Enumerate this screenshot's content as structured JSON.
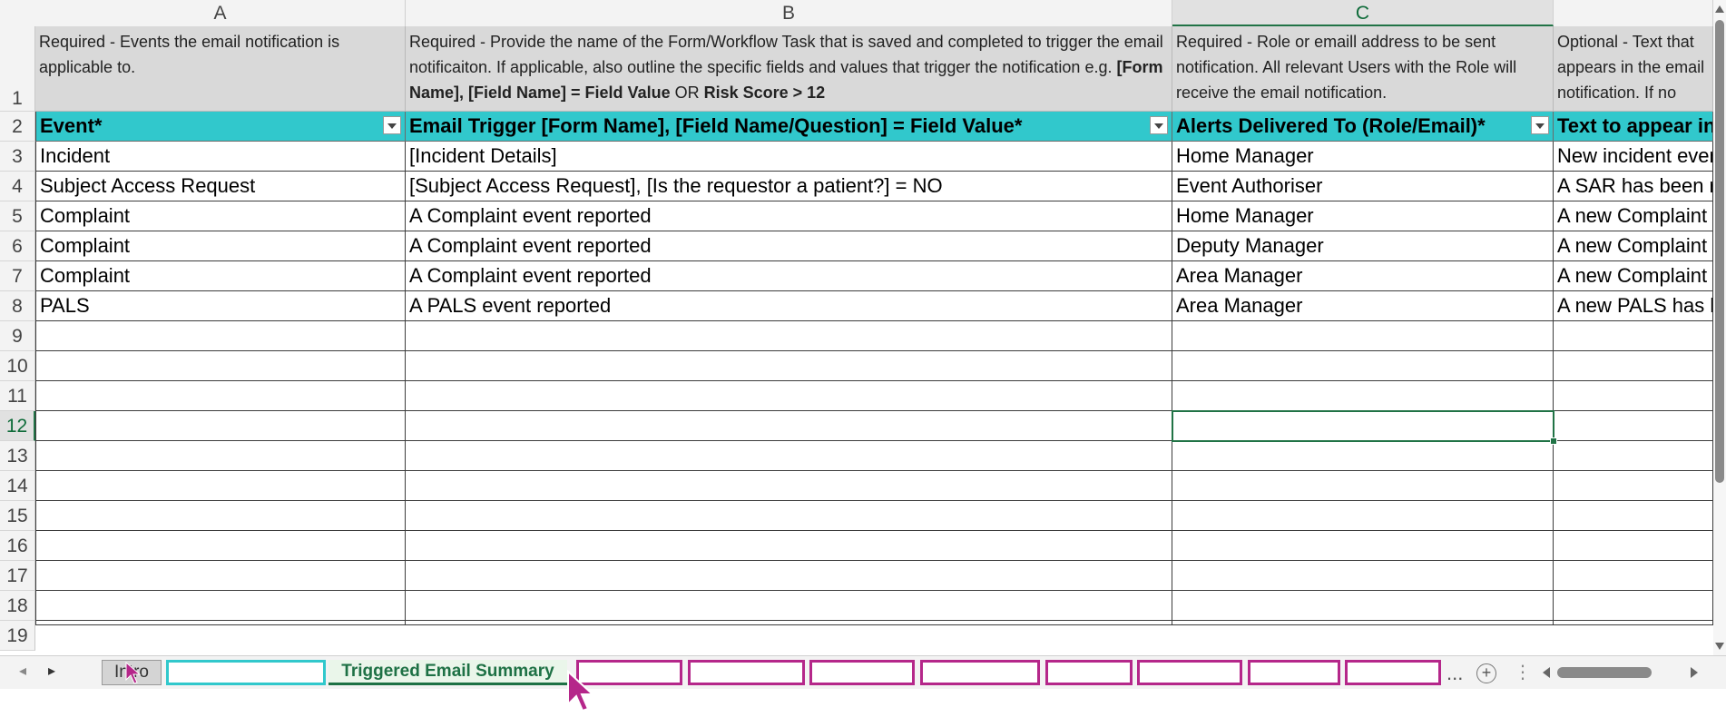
{
  "columns": [
    {
      "letter": "A"
    },
    {
      "letter": "B"
    },
    {
      "letter": "C"
    },
    {
      "letter": ""
    }
  ],
  "row_numbers": [
    "1",
    "2",
    "3",
    "4",
    "5",
    "6",
    "7",
    "8",
    "9",
    "10",
    "11",
    "12",
    "13",
    "14",
    "15",
    "16",
    "17",
    "18",
    "19"
  ],
  "descriptions": {
    "a": "Required - Events the email notification is applicable to.",
    "b_part1": "Required - Provide the name of the Form/Workflow Task that is saved and completed to trigger the email notificaiton. If applicable, also outline the specific fields and values that trigger the notification e.g. ",
    "b_bold1": "[Form Name], [Field Name] = Field Value",
    "b_or": " OR ",
    "b_bold2": "Risk Score > 12",
    "c": "Required - Role or emaill address to be sent notification. All relevant Users with the Role will receive the email notification.",
    "d": "Optional - Text that appears in the email notification. If no description is required"
  },
  "headers": {
    "a": "Event*",
    "b": "Email Trigger [Form Name], [Field Name/Question] = Field Value*",
    "c": "Alerts Delivered To (Role/Email)*",
    "d": "Text to appear in email*"
  },
  "rows": [
    {
      "event": "Incident",
      "trigger": "[Incident Details]",
      "recipient": "Home Manager",
      "text": "New incident event reported"
    },
    {
      "event": "Subject Access Request",
      "trigger": "[Subject Access Request], [Is the requestor a patient?] = NO",
      "recipient": "Event Authoriser",
      "text": "A SAR has been received"
    },
    {
      "event": "Complaint",
      "trigger": "A Complaint event reported",
      "recipient": "Home Manager",
      "text": "A new Complaint has been reported"
    },
    {
      "event": "Complaint",
      "trigger": "A Complaint event reported",
      "recipient": "Deputy Manager",
      "text": "A new Complaint has been reported"
    },
    {
      "event": "Complaint",
      "trigger": "A Complaint event reported",
      "recipient": "Area Manager",
      "text": "A new Complaint has been reported"
    },
    {
      "event": "PALS",
      "trigger": "A PALS event reported",
      "recipient": "Area Manager",
      "text": "A new PALS has been reported"
    }
  ],
  "tabs": {
    "intro": "Intro",
    "active": "Triggered Email Summary",
    "more": "...",
    "add": "+",
    "menu": "⋮"
  },
  "colors": {
    "header_fill": "#31c8cc",
    "description_fill": "#d9d9d9",
    "tab_magenta": "#b5278a",
    "selection_green": "#217346"
  }
}
